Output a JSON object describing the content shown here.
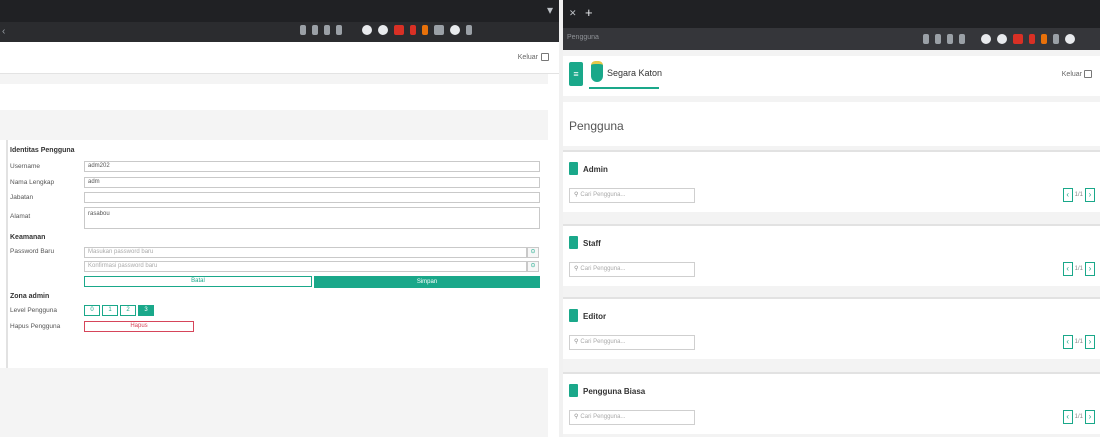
{
  "left_window": {
    "header": {
      "logout_label": "Keluar"
    },
    "identitas": {
      "section_title": "Identitas Pengguna",
      "username_label": "Username",
      "username_value": "adm202",
      "nama_label": "Nama Lengkap",
      "nama_value": "adm",
      "jabatan_label": "Jabatan",
      "jabatan_value": "",
      "alamat_label": "Alamat",
      "alamat_value": "rasabou"
    },
    "keamanan": {
      "section_title": "Keamanan",
      "password_label": "Password Baru",
      "password_placeholder": "Masukan password baru",
      "confirm_placeholder": "Konfirmasi password baru",
      "eye_glyph": "⊙",
      "batal_label": "Batal",
      "simpan_label": "Simpan"
    },
    "zona_admin": {
      "section_title": "Zona admin",
      "level_label": "Level Pengguna",
      "levels": [
        "0",
        "1",
        "2",
        "3"
      ],
      "active_level": "3",
      "hapus_label": "Hapus Pengguna",
      "hapus_button": "Hapus"
    }
  },
  "right_window": {
    "tab": {
      "close_glyph": "✕",
      "new_glyph": "+"
    },
    "url_text": "Pengguna",
    "header": {
      "menu_glyph": "≡",
      "brand": "Segara Katon",
      "logout_label": "Keluar"
    },
    "page_title": "Pengguna",
    "cards": [
      {
        "title": "Admin",
        "search_placeholder": "Cari Pengguna...",
        "page_text": "1/1"
      },
      {
        "title": "Staff",
        "search_placeholder": "Cari Pengguna...",
        "page_text": "1/1"
      },
      {
        "title": "Editor",
        "search_placeholder": "Cari Pengguna...",
        "page_text": "1/1"
      },
      {
        "title": "Pengguna Biasa",
        "search_placeholder": "Cari Pengguna...",
        "page_text": "1/1"
      }
    ],
    "pager": {
      "prev": "‹",
      "next": "›"
    }
  },
  "colors": {
    "accent": "#1aa88a",
    "danger": "#d6455a",
    "chrome": "#202124"
  }
}
